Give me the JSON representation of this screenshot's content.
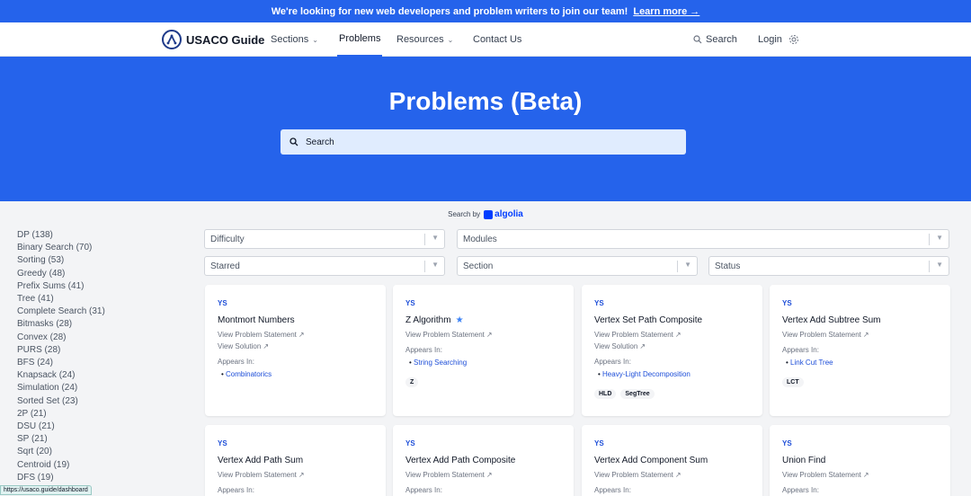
{
  "banner": {
    "text": "We're looking for new web developers and problem writers to join our team!",
    "link": "Learn more →"
  },
  "nav": {
    "logo": "USACO Guide",
    "sections": "Sections",
    "problems": "Problems",
    "resources": "Resources",
    "contact": "Contact Us",
    "search": "Search",
    "login": "Login"
  },
  "hero": {
    "title": "Problems (Beta)",
    "search_placeholder": "Search"
  },
  "algolia": {
    "prefix": "Search by",
    "brand": "algolia"
  },
  "sidebar": [
    "DP (138)",
    "Binary Search (70)",
    "Sorting (53)",
    "Greedy (48)",
    "Prefix Sums (41)",
    "Tree (41)",
    "Complete Search (31)",
    "Bitmasks (28)",
    "Convex (28)",
    "PURS (28)",
    "BFS (24)",
    "Knapsack (24)",
    "Simulation (24)",
    "Sorted Set (23)",
    "2P (21)",
    "DSU (21)",
    "SP (21)",
    "Sqrt (20)",
    "Centroid (19)",
    "DFS (19)"
  ],
  "filters": {
    "difficulty": "Difficulty",
    "modules": "Modules",
    "starred": "Starred",
    "section": "Section",
    "status": "Status"
  },
  "cards": [
    {
      "source": "YS",
      "title": "Montmort Numbers",
      "statement": "View Problem Statement",
      "solution": "View Solution",
      "appears": "Appears In:",
      "module": "Combinatorics"
    },
    {
      "source": "YS",
      "title": "Z Algorithm",
      "statement": "View Problem Statement",
      "appears": "Appears In:",
      "module": "String Searching",
      "tags": [
        "Z"
      ]
    },
    {
      "source": "YS",
      "title": "Vertex Set Path Composite",
      "statement": "View Problem Statement",
      "solution": "View Solution",
      "appears": "Appears In:",
      "module": "Heavy-Light Decomposition",
      "tags": [
        "HLD",
        "SegTree"
      ]
    },
    {
      "source": "YS",
      "title": "Vertex Add Subtree Sum",
      "statement": "View Problem Statement",
      "appears": "Appears In:",
      "module": "Link Cut Tree",
      "tags": [
        "LCT"
      ]
    },
    {
      "source": "YS",
      "title": "Vertex Add Path Sum",
      "statement": "View Problem Statement",
      "appears": "Appears In:"
    },
    {
      "source": "YS",
      "title": "Vertex Add Path Composite",
      "statement": "View Problem Statement",
      "appears": "Appears In:"
    },
    {
      "source": "YS",
      "title": "Vertex Add Component Sum",
      "statement": "View Problem Statement",
      "appears": "Appears In:"
    },
    {
      "source": "YS",
      "title": "Union Find",
      "statement": "View Problem Statement",
      "appears": "Appears In:"
    }
  ],
  "status_bar": "https://usaco.guide/dashboard"
}
